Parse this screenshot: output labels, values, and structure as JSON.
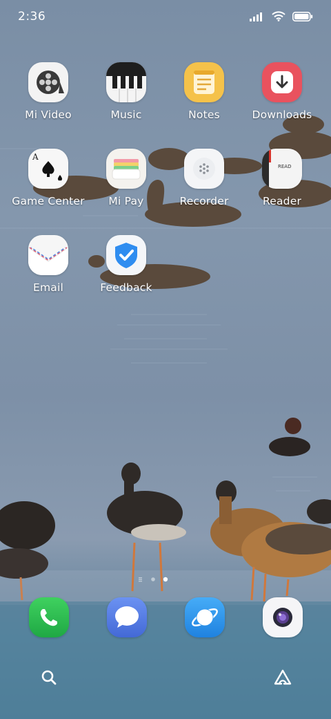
{
  "status_bar": {
    "time": "2:36",
    "icons": [
      "signal-icon",
      "wifi-icon",
      "battery-icon"
    ]
  },
  "apps": [
    {
      "name": "mi-video",
      "label": "Mi Video",
      "icon": "film-reel-icon"
    },
    {
      "name": "music",
      "label": "Music",
      "icon": "piano-keys-icon"
    },
    {
      "name": "notes",
      "label": "Notes",
      "icon": "notepad-icon"
    },
    {
      "name": "downloads",
      "label": "Downloads",
      "icon": "download-arrow-icon"
    },
    {
      "name": "game-center",
      "label": "Game Center",
      "icon": "playing-card-icon"
    },
    {
      "name": "mi-pay",
      "label": "Mi Pay",
      "icon": "wallet-icon"
    },
    {
      "name": "recorder",
      "label": "Recorder",
      "icon": "microphone-grille-icon"
    },
    {
      "name": "reader",
      "label": "Reader",
      "icon": "book-icon"
    },
    {
      "name": "email",
      "label": "Email",
      "icon": "envelope-icon"
    },
    {
      "name": "feedback",
      "label": "Feedback",
      "icon": "shield-check-icon"
    }
  ],
  "reader_icon_text": "READ",
  "page_indicator": {
    "pages": 3,
    "current": 3
  },
  "dock": [
    {
      "name": "phone",
      "icon": "phone-icon"
    },
    {
      "name": "messages",
      "icon": "chat-bubble-icon"
    },
    {
      "name": "browser",
      "icon": "planet-icon"
    },
    {
      "name": "camera",
      "icon": "camera-lens-icon"
    }
  ],
  "bottom_bar": [
    {
      "name": "search",
      "icon": "search-icon"
    },
    {
      "name": "assistant",
      "icon": "triangle-logo-icon"
    }
  ],
  "colors": {
    "downloads_red": "#e9525e",
    "notes_yellow": "#f5c24a",
    "feedback_blue": "#2f8df0",
    "phone_green": "#2fc24f",
    "messages_blue": "#4f7fe6",
    "browser_blue": "#2e96ef"
  }
}
